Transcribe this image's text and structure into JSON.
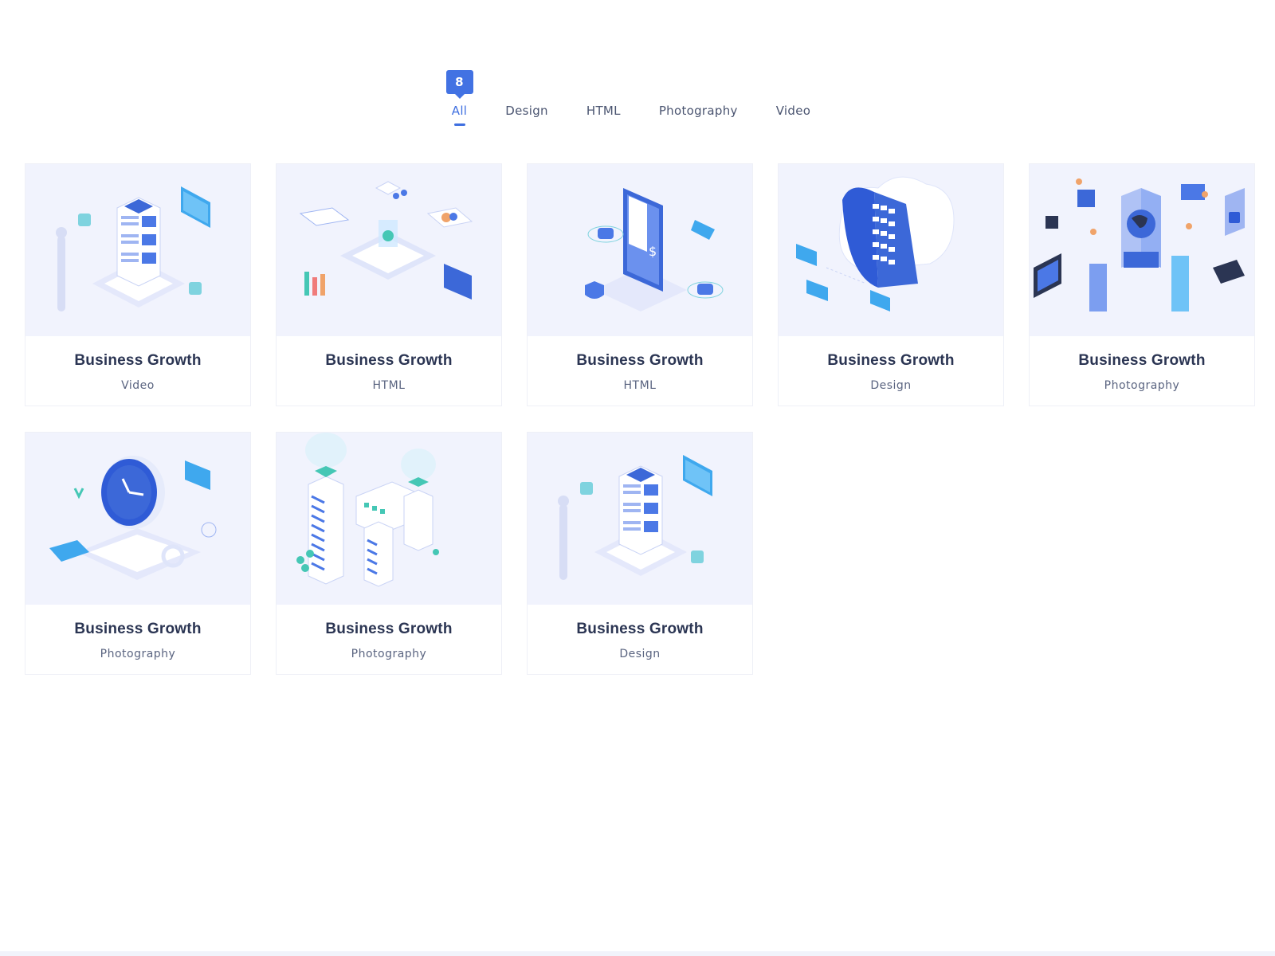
{
  "filters": {
    "count": "8",
    "tabs": [
      {
        "label": "All",
        "active": true
      },
      {
        "label": "Design",
        "active": false
      },
      {
        "label": "HTML",
        "active": false
      },
      {
        "label": "Photography",
        "active": false
      },
      {
        "label": "Video",
        "active": false
      }
    ]
  },
  "colors": {
    "accent": "#4272e3",
    "thumb_bg": "#f1f3fd",
    "title": "#2b3553"
  },
  "cards": [
    {
      "title": "Business Growth",
      "category": "Video",
      "illustration": "server-stack-icon"
    },
    {
      "title": "Business Growth",
      "category": "HTML",
      "illustration": "platform-dashboard-icon"
    },
    {
      "title": "Business Growth",
      "category": "HTML",
      "illustration": "mobile-payment-icon"
    },
    {
      "title": "Business Growth",
      "category": "Design",
      "illustration": "cloud-server-icon"
    },
    {
      "title": "Business Growth",
      "category": "Photography",
      "illustration": "team-network-icon"
    },
    {
      "title": "Business Growth",
      "category": "Photography",
      "illustration": "clock-time-icon"
    },
    {
      "title": "Business Growth",
      "category": "Photography",
      "illustration": "smart-city-icon"
    },
    {
      "title": "Business Growth",
      "category": "Design",
      "illustration": "server-stack-icon"
    }
  ]
}
